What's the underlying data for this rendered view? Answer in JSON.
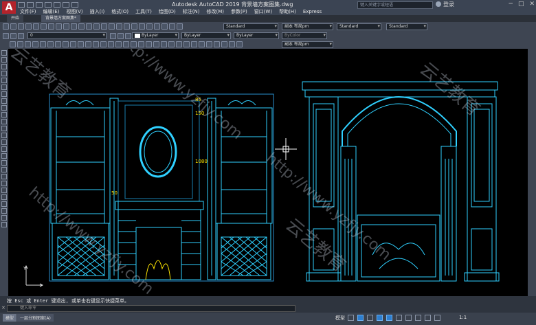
{
  "app": {
    "title": "Autodesk AutoCAD 2019    背景墙方案图集.dwg",
    "search_placeholder": "键入关键字或短语",
    "login_label": "登录",
    "window_controls": [
      "─",
      "□",
      "✕"
    ]
  },
  "menu": [
    "文件(F)",
    "编辑(E)",
    "视图(V)",
    "插入(I)",
    "格式(O)",
    "工具(T)",
    "绘图(D)",
    "标注(N)",
    "修改(M)",
    "参数(P)",
    "窗口(W)",
    "帮助(H)",
    "Express"
  ],
  "tabs": [
    {
      "label": "开始"
    },
    {
      "label": "背景墙方案图集*"
    }
  ],
  "toolbar": {
    "layer_value": "0",
    "color_value": "ByLayer",
    "linetype_value": "ByLayer",
    "lineweight_value": "ByLayer",
    "plotstyle_value": "ByColor",
    "text_style": "Standard",
    "dim_style": "副本 布局pm",
    "table_style": "Standard",
    "mleader_style": "Standard",
    "multileader_value": "副本 布局pm"
  },
  "command": {
    "history": "按 Esc 或 Enter 键退出, 或单击右键显示快捷菜单。",
    "input_placeholder": "键入命令"
  },
  "status": {
    "layout_tabs": [
      "模型",
      "一层分割图案(A)"
    ],
    "model_label": "模型",
    "scale": "1:1"
  },
  "drawing": {
    "colors": {
      "primary": "#2fd0ff",
      "secondary": "#0aa6d8",
      "dim": "#ffe600",
      "bg": "#000000"
    },
    "dimension_labels": [
      "85",
      "150",
      "1080",
      "50"
    ],
    "watermark_text": [
      "云艺教育",
      "http://www.yzfjy.com"
    ]
  }
}
